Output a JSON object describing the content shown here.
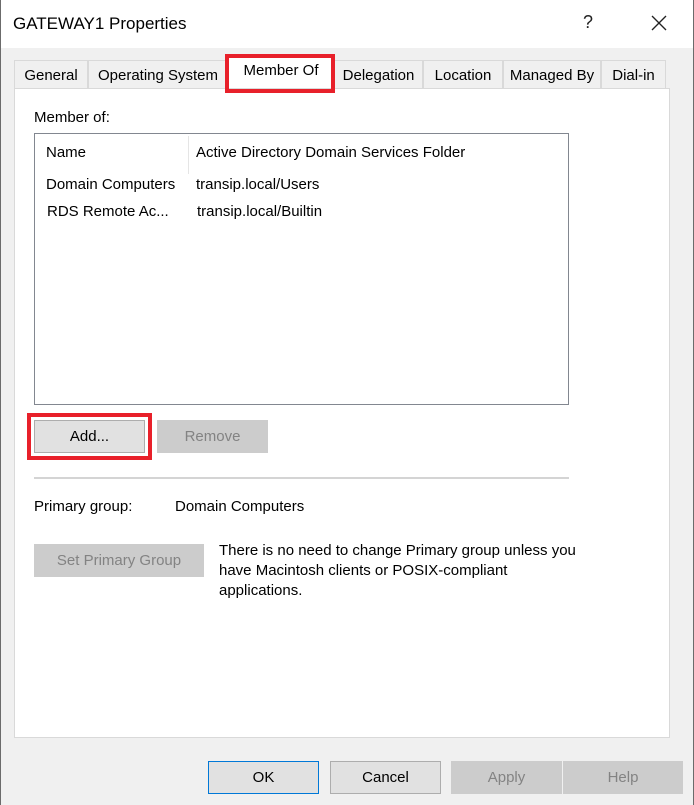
{
  "window": {
    "title": "GATEWAY1 Properties",
    "help_glyph": "?",
    "close_glyph": "✕"
  },
  "tabs": [
    {
      "label": "General",
      "active": false
    },
    {
      "label": "Operating System",
      "active": false
    },
    {
      "label": "Member Of",
      "active": true,
      "highlighted": true
    },
    {
      "label": "Delegation",
      "active": false
    },
    {
      "label": "Location",
      "active": false
    },
    {
      "label": "Managed By",
      "active": false
    },
    {
      "label": "Dial-in",
      "active": false
    }
  ],
  "member_of": {
    "label": "Member of:",
    "columns": [
      "Name",
      "Active Directory Domain Services Folder"
    ],
    "rows": [
      {
        "name": "Domain Computers",
        "folder": "transip.local/Users"
      },
      {
        "name": "RDS Remote Ac...",
        "folder": "transip.local/Builtin"
      }
    ],
    "add_label": "Add...",
    "remove_label": "Remove"
  },
  "primary_group": {
    "label": "Primary group:",
    "value": "Domain Computers",
    "set_button_label": "Set Primary Group",
    "note": "There is no need to change Primary group unless you have Macintosh clients or POSIX-compliant applications."
  },
  "footer": {
    "ok_label": "OK",
    "cancel_label": "Cancel",
    "apply_label": "Apply",
    "help_label": "Help"
  },
  "colors": {
    "highlight": "#e8202a",
    "default_button_border": "#0078d7"
  }
}
